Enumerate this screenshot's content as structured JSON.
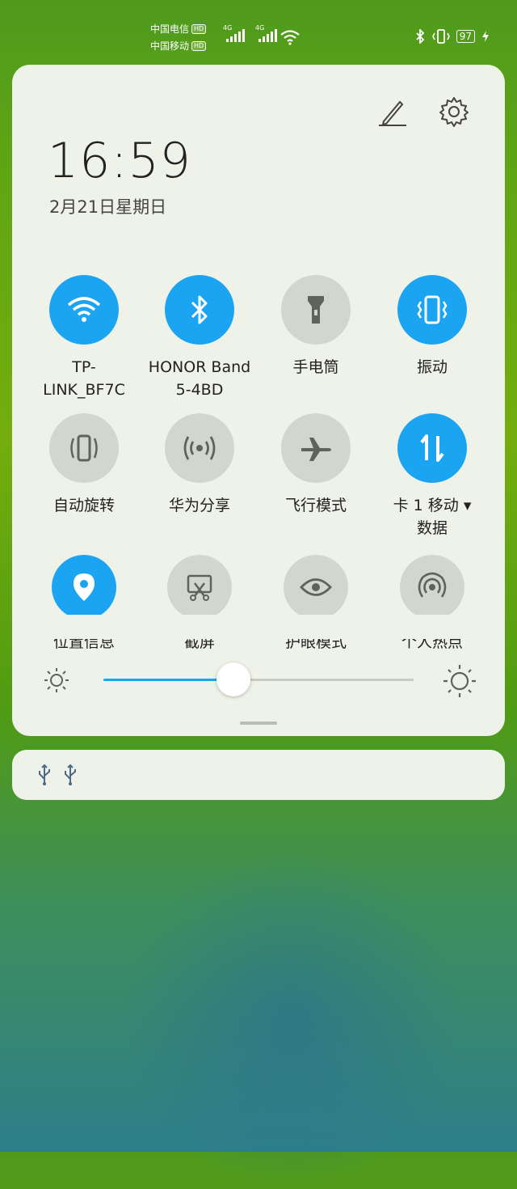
{
  "status_bar": {
    "carrier1": "中国电信",
    "carrier2": "中国移动",
    "hd_badge": "HD",
    "network1": "4G",
    "network2": "4G",
    "battery": "97"
  },
  "header": {
    "time": "16:59",
    "date": "2月21日星期日",
    "edit_icon": "pencil-icon",
    "settings_icon": "gear-icon"
  },
  "tiles": [
    {
      "label": "TP-\nLINK_BF7C",
      "icon": "wifi-icon",
      "state": "on"
    },
    {
      "label": "HONOR Band\n5-4BD",
      "icon": "bluetooth-icon",
      "state": "on"
    },
    {
      "label": "手电筒",
      "icon": "flashlight-icon",
      "state": "off"
    },
    {
      "label": "振动",
      "icon": "vibrate-icon",
      "state": "on"
    },
    {
      "label": "自动旋转",
      "icon": "auto-rotate-icon",
      "state": "off"
    },
    {
      "label": "华为分享",
      "icon": "huawei-share-icon",
      "state": "off"
    },
    {
      "label": "飞行模式",
      "icon": "airplane-icon",
      "state": "off"
    },
    {
      "label": "卡 1 移动 ▾\n数据",
      "icon": "mobile-data-icon",
      "state": "on"
    },
    {
      "label": "位置信息",
      "icon": "location-icon",
      "state": "on"
    },
    {
      "label": "截屏",
      "icon": "screenshot-icon",
      "state": "off"
    },
    {
      "label": "护眼模式",
      "icon": "eye-comfort-icon",
      "state": "off"
    },
    {
      "label": "个人热点",
      "icon": "hotspot-icon",
      "state": "off"
    }
  ],
  "brightness": {
    "level": 0.42
  },
  "notification": {
    "icons": [
      "usb-icon",
      "usb-icon"
    ]
  },
  "colors": {
    "accent": "#1ba4f2",
    "tile_off": "#d2d6cd",
    "panel": "#eef2e8"
  }
}
